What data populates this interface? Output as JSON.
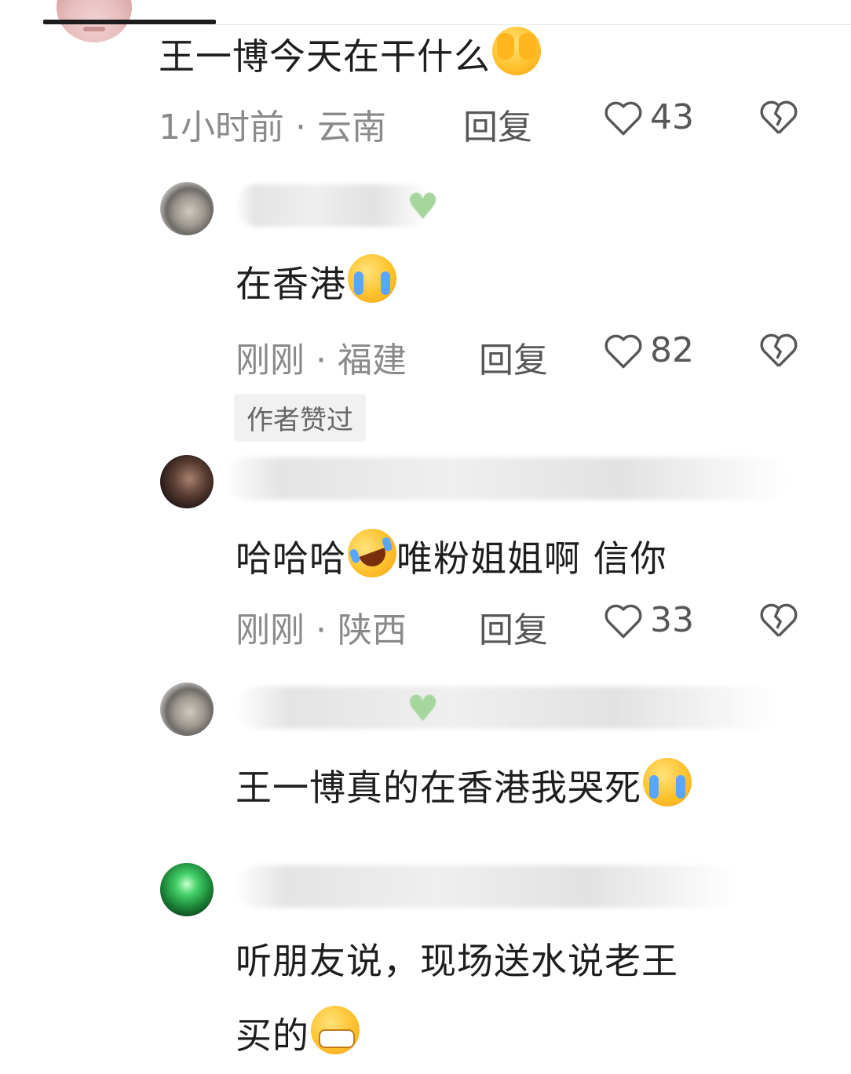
{
  "root_comment": {
    "text": "王一博今天在干什么",
    "emoji": "see-no-evil-icon",
    "time": "1小时前",
    "location": "云南",
    "reply_label": "回复",
    "likes": "43"
  },
  "replies": [
    {
      "username": "",
      "badge_icon": "green-heart-icon",
      "text": "在香港",
      "emoji": "loudly-crying-face-icon",
      "time": "刚刚",
      "location": "福建",
      "reply_label": "回复",
      "likes": "82",
      "author_tag": "作者赞过"
    },
    {
      "username": "",
      "text_parts": [
        "哈哈哈",
        "唯粉姐姐啊 信你"
      ],
      "emoji": "rolling-on-floor-laughing-icon",
      "time": "刚刚",
      "location": "陕西",
      "reply_label": "回复",
      "likes": "33"
    },
    {
      "username": "",
      "badge_icon": "green-heart-icon",
      "text": "王一博真的在香港我哭死",
      "emoji": "loudly-crying-face-icon"
    },
    {
      "username": "",
      "text_lines": [
        "听朋友说，现场送水说老王",
        "买的"
      ],
      "emoji": "grinning-face-icon"
    }
  ],
  "colors": {
    "meta_gray": "#8a8a8a",
    "badge_green": "#a7d59e"
  }
}
